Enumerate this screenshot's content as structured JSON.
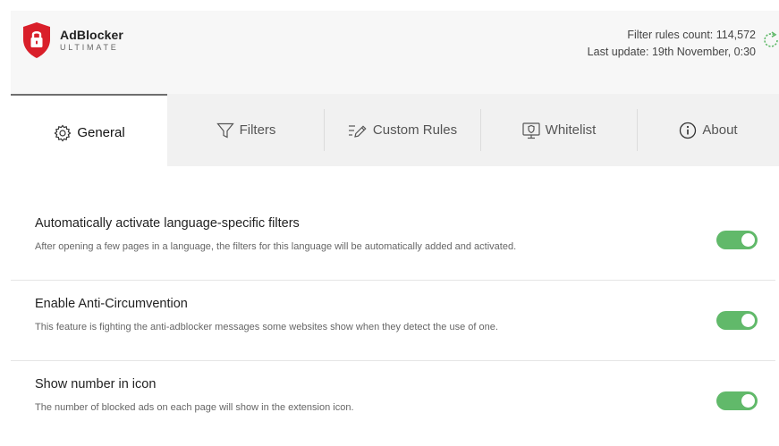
{
  "app": {
    "brand_name": "AdBlocker",
    "brand_sub": "ULTIMATE",
    "accent_color": "#d91f2a",
    "toggle_color": "#61b96a"
  },
  "header": {
    "rules_count": "Filter rules count: 114,572",
    "last_update": "Last update: 19th November, 0:30",
    "refresh_icon": "refresh-icon"
  },
  "tabs": [
    {
      "label": "General",
      "icon": "gear-icon",
      "active": true
    },
    {
      "label": "Filters",
      "icon": "funnel-icon",
      "active": false
    },
    {
      "label": "Custom Rules",
      "icon": "edit-list-icon",
      "active": false
    },
    {
      "label": "Whitelist",
      "icon": "monitor-shield-icon",
      "active": false
    },
    {
      "label": "About",
      "icon": "info-icon",
      "active": false
    }
  ],
  "settings": [
    {
      "title": "Automatically activate language-specific filters",
      "description": "After opening a few pages in a language, the filters for this language will be automatically added and activated.",
      "enabled": true
    },
    {
      "title": "Enable Anti-Circumvention",
      "description": "This feature is fighting the anti-adblocker messages some websites show when they detect the use of one.",
      "enabled": true
    },
    {
      "title": "Show number in icon",
      "description": "The number of blocked ads on each page will show in the extension icon.",
      "enabled": true
    }
  ]
}
